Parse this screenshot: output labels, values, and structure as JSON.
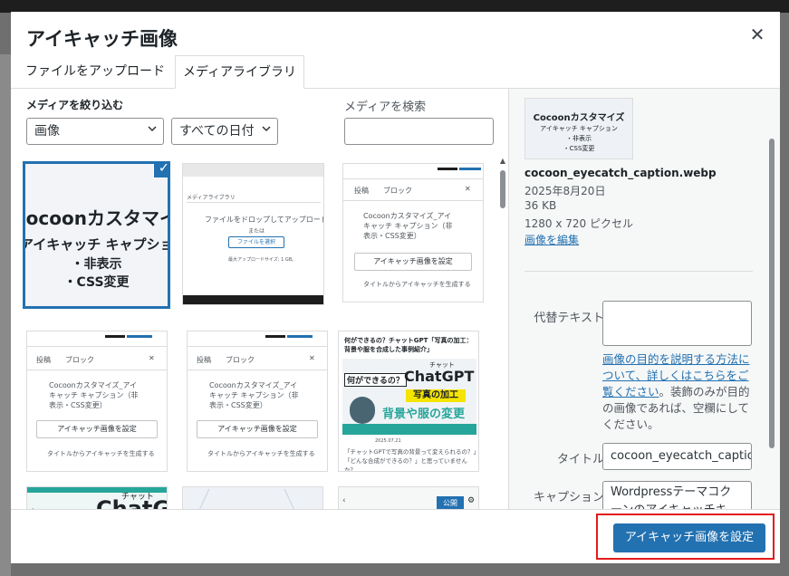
{
  "modal": {
    "title": "アイキャッチ画像",
    "close_icon": "close-icon"
  },
  "tabs": [
    {
      "label": "ファイルをアップロード",
      "active": false
    },
    {
      "label": "メディアライブラリ",
      "active": true
    }
  ],
  "filter": {
    "label": "メディアを絞り込む",
    "type_select": "画像",
    "date_select": "すべての日付",
    "search_label": "メディアを検索",
    "search_value": ""
  },
  "grid": {
    "thumb1": {
      "line1": "Cocoonカスタマイズ",
      "line2": "アイキャッチ キャプション",
      "line3": "・非表示",
      "line4": "・CSS変更"
    },
    "thumb2": {
      "tab": "メディアライブラリ",
      "drop": "ファイルをドロップしてアップロード",
      "or": "または",
      "select": "ファイルを選択",
      "max": "最大アップロードサイズ: 1 GB。"
    },
    "thumb3": {
      "tab1": "投稿",
      "tab2": "ブロック",
      "title": "Cocoonカスタマイズ_アイキャッチ キャプション（非表示・CSS変更）",
      "button": "アイキャッチ画像を設定",
      "check": "タイトルからアイキャッチを生成する"
    },
    "thumb4": {
      "tab1": "投稿",
      "tab2": "ブロック",
      "title": "Cocoonカスタマイズ_アイキャッチ キャプション（非表示・CSS変更）",
      "button": "アイキャッチ画像を設定",
      "check": "タイトルからアイキャッチを生成する"
    },
    "thumb6": {
      "heading": "何ができるの？チャットGPT「写真の加工：背景や服を合成した事例紹介」",
      "q": "何ができるの？",
      "chatgpt": "ChatGPT",
      "chatto": "チャット",
      "edit": "写真の加工",
      "bg": "背景や服の変更",
      "date": "2025.07.21",
      "text": "「チャットGPTで写真の背景って変えられるの？」「どんな合成ができるの？」と思っていませんか？"
    },
    "thumb9": {
      "publish": "公開"
    }
  },
  "sidebar": {
    "thumb_line1": "Cocoonカスタマイズ",
    "thumb_line2": "アイキャッチ キャプション",
    "thumb_line3": "・非表示",
    "thumb_line4": "・CSS変更",
    "filename": "cocoon_eyecatch_caption.webp",
    "date": "2025年8月20日",
    "size": "36 KB",
    "dimensions": "1280 x 720 ピクセル",
    "edit_link": "画像を編集",
    "alt_label": "代替テキスト",
    "alt_value": "",
    "help_link": "画像の目的を説明する方法について、詳しくはこちらをご覧ください",
    "help_text": "。装飾のみが目的の画像であれば、空欄にしてください。",
    "title_label": "タイトル",
    "title_value": "cocoon_eyecatch_caption",
    "caption_label": "キャプション",
    "caption_value": "Wordpressテーマコクーンのアイキャッチキ"
  },
  "footer": {
    "primary_button": "アイキャッチ画像を設定"
  },
  "colors": {
    "accent": "#2271b1",
    "highlight": "#e31b1b"
  }
}
